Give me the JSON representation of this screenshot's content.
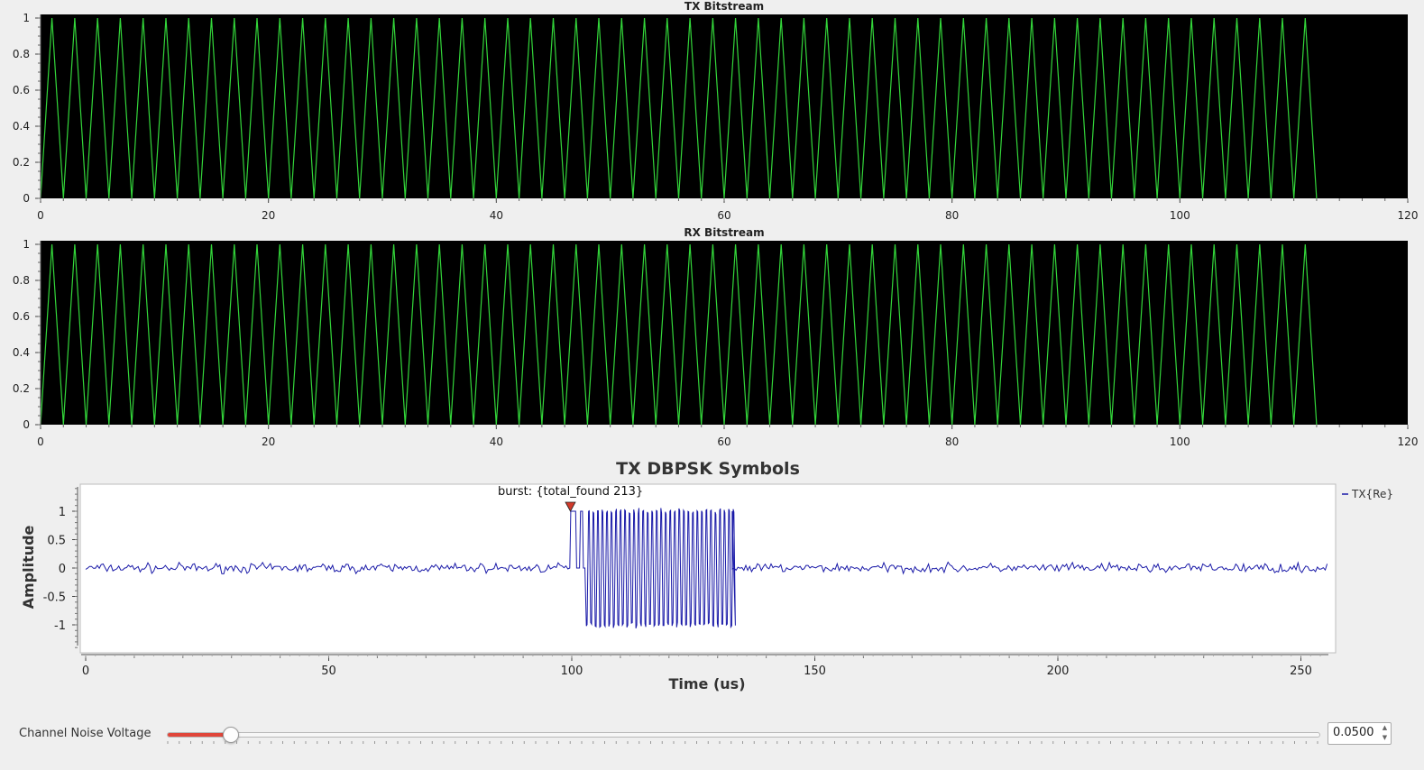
{
  "tx_plot": {
    "title": "TX Bitstream",
    "chart_data": {
      "type": "line",
      "title": "TX Bitstream",
      "xlim": [
        0,
        120
      ],
      "ylim": [
        0,
        1
      ],
      "x_ticks": [
        "0",
        "20",
        "40",
        "60",
        "80",
        "100",
        "120"
      ],
      "y_ticks": [
        "0",
        "0.2",
        "0.4",
        "0.6",
        "0.8",
        "1"
      ],
      "pattern": "alternating 0,1,0,1,... from x=0 to x=112",
      "x_start": 0,
      "x_end": 112,
      "values_even_index": 0,
      "values_odd_index": 1,
      "grid": false,
      "line_color": "#33d63a",
      "background": "#000000"
    }
  },
  "rx_plot": {
    "title": "RX Bitstream",
    "chart_data": {
      "type": "line",
      "title": "RX Bitstream",
      "xlim": [
        0,
        120
      ],
      "ylim": [
        0,
        1
      ],
      "x_ticks": [
        "0",
        "20",
        "40",
        "60",
        "80",
        "100",
        "120"
      ],
      "y_ticks": [
        "0",
        "0.2",
        "0.4",
        "0.6",
        "0.8",
        "1"
      ],
      "pattern": "alternating 0,1,0,1,... from x=0 to x=112",
      "x_start": 0,
      "x_end": 112,
      "values_even_index": 0,
      "values_odd_index": 1,
      "grid": false,
      "line_color": "#33d63a",
      "background": "#000000"
    }
  },
  "time_plot": {
    "title": "TX DBPSK Symbols",
    "xlabel": "Time (us)",
    "ylabel": "Amplitude",
    "legend": "TX{Re}",
    "tag_text": "burst: {total_found 213}",
    "chart_data": {
      "type": "line",
      "title": "TX DBPSK Symbols",
      "xlabel": "Time (us)",
      "ylabel": "Amplitude",
      "xlim": [
        0,
        256
      ],
      "ylim": [
        -1.5,
        1.5
      ],
      "x_ticks": [
        "0",
        "50",
        "100",
        "150",
        "200",
        "250"
      ],
      "y_ticks": [
        "1",
        "0.5",
        "0",
        "-0.5",
        "-1"
      ],
      "series": [
        {
          "name": "TX{Re}",
          "color": "#1a1aa8"
        }
      ],
      "noise_std": 0.04,
      "burst": {
        "preamble": [
          [
            100,
            1
          ],
          [
            101.5,
            1
          ],
          [
            102.5,
            1
          ]
        ],
        "x_start": 103,
        "x_end": 133,
        "amplitude": 1
      },
      "tag": {
        "x": 100,
        "y": 1.05,
        "label": "burst: {total_found 213}"
      },
      "legend_position": "right",
      "grid": false
    }
  },
  "control": {
    "label": "Channel Noise Voltage",
    "value": "0.0500",
    "fraction": 0.055,
    "accent": "#e0463a"
  }
}
